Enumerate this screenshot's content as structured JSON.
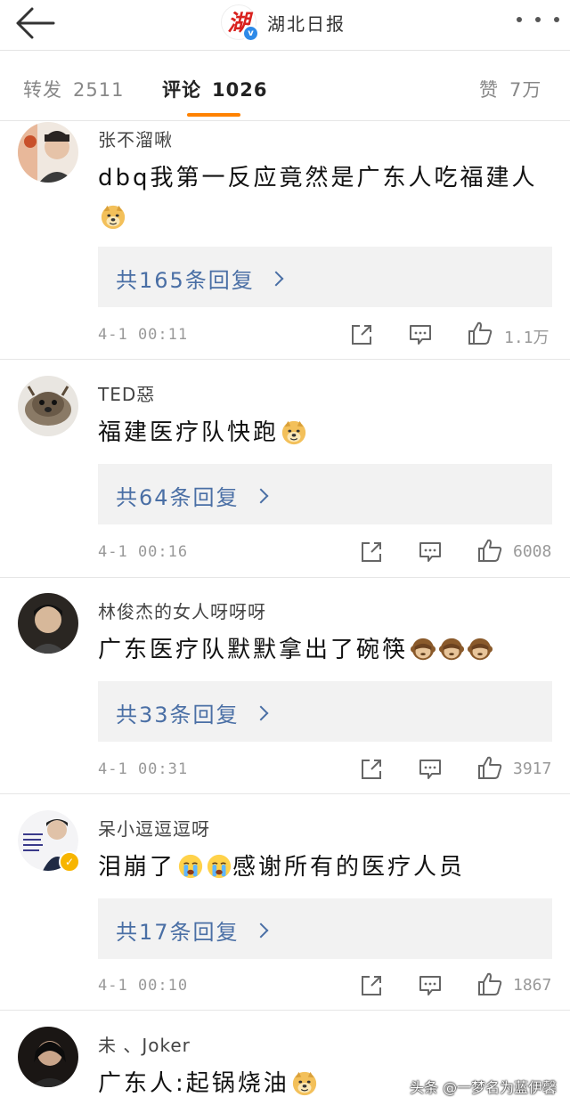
{
  "header": {
    "account_name": "湖北日报",
    "logo_glyph": "湖",
    "verified_mark": "v"
  },
  "tabs": [
    {
      "label": "转发",
      "count": "2511"
    },
    {
      "label": "评论",
      "count": "1026"
    },
    {
      "label": "赞",
      "count": "7万"
    }
  ],
  "comments": [
    {
      "user": "张不溜啾",
      "text": "dbq我第一反应竟然是广东人吃福建人",
      "replies": "共165条回复",
      "time": "4-1 00:11",
      "likes": "1.1万"
    },
    {
      "user": "TED惡",
      "text": "福建医疗队快跑",
      "replies": "共64条回复",
      "time": "4-1 00:16",
      "likes": "6008"
    },
    {
      "user": "林俊杰的女人呀呀呀",
      "text": "广东医疗队默默拿出了碗筷",
      "replies": "共33条回复",
      "time": "4-1 00:31",
      "likes": "3917"
    },
    {
      "user": "呆小逗逗逗呀",
      "text_a": "泪崩了",
      "text_b": "感谢所有的医疗人员",
      "replies": "共17条回复",
      "time": "4-1 00:10",
      "likes": "1867"
    },
    {
      "user": "未 、Joker",
      "text": "广东人:起锅烧油"
    }
  ],
  "watermark": "头条 @一梦名为蓝伊馨",
  "colors": {
    "accent": "#ff8200",
    "reply_link": "#4a6fa5",
    "logo_red": "#d9211e",
    "verified": "#2e8ae8"
  }
}
